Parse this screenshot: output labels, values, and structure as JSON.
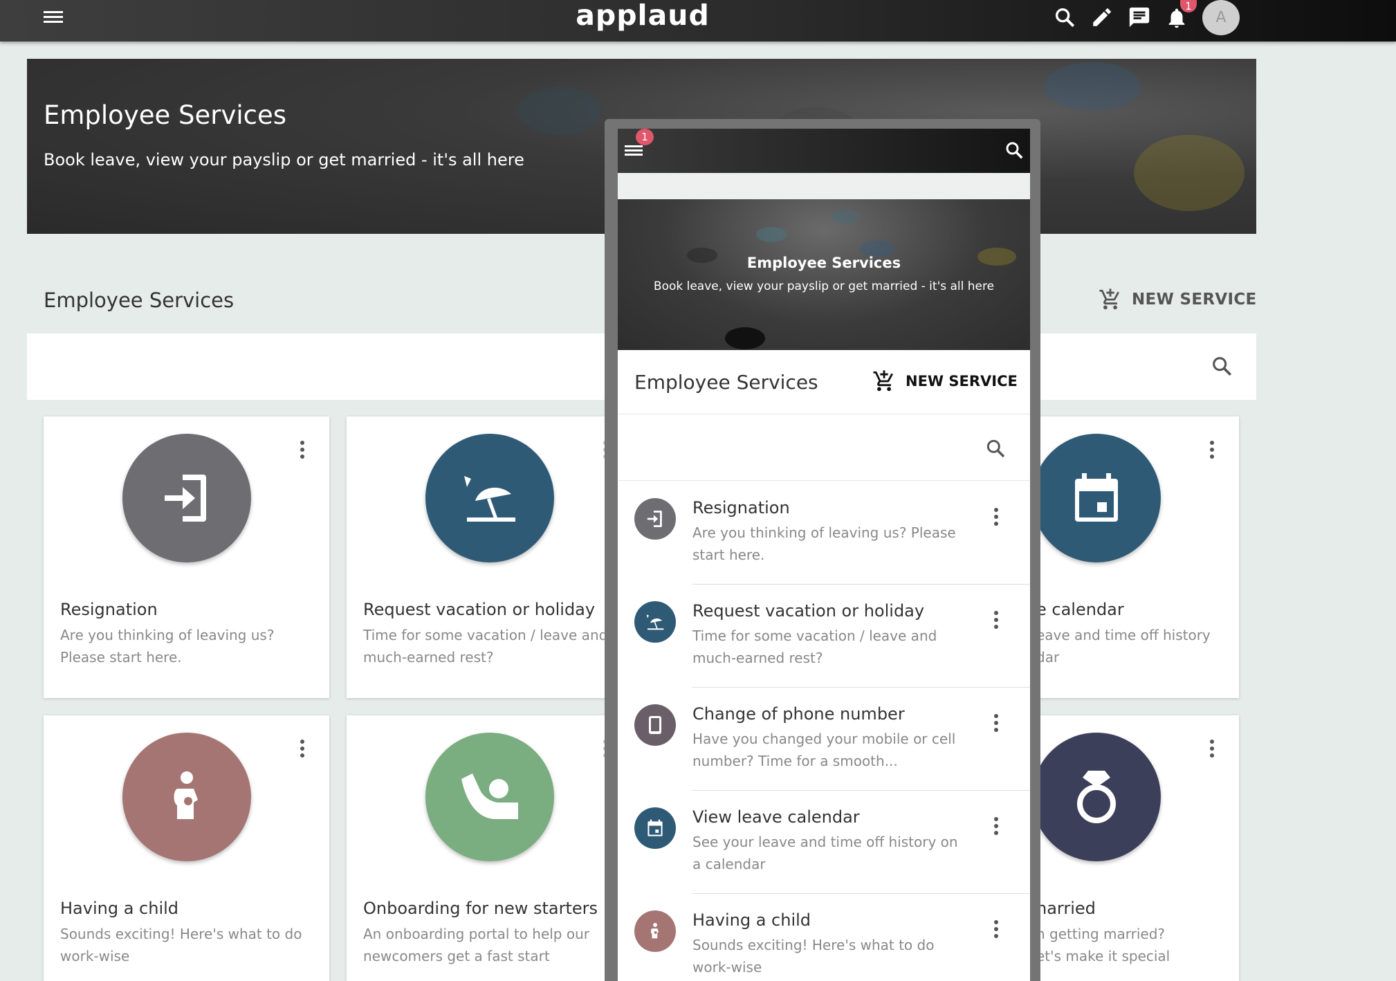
{
  "app": {
    "logo": "applaud",
    "notification_count": "1",
    "avatar_initial": "A",
    "icons": [
      "menu-icon",
      "search-icon",
      "edit-icon",
      "chat-icon",
      "bell-icon"
    ]
  },
  "hero": {
    "title": "Employee Services",
    "subtitle": "Book leave, view your payslip or get married - it's all here"
  },
  "section": {
    "title": "Employee Services",
    "new_service_label": "NEW SERVICE"
  },
  "cards": [
    {
      "title": "Resignation",
      "desc": "Are you thinking of leaving us? Please start here.",
      "icon": "resignation-icon",
      "color": "#6d6d72"
    },
    {
      "title": "Request vacation or holiday",
      "desc": "Time for some vacation / leave and much-earned rest?",
      "icon": "beach-icon",
      "color": "#2f5a76"
    },
    {
      "title": "e calendar",
      "desc": "eave and time off history\ndar",
      "icon": "calendar-icon",
      "color": "#2f5a76"
    },
    {
      "title": "Having a child",
      "desc": "Sounds exciting! Here's what to do work-wise",
      "icon": "pregnant-icon",
      "color": "#a57573"
    },
    {
      "title": "Onboarding for new starters",
      "desc": "An onboarding portal to help our newcomers get a fast start",
      "icon": "onboarding-icon",
      "color": "#7aad80"
    },
    {
      "title": "narried",
      "desc": "n getting married?\net's make it special",
      "icon": "ring-icon",
      "color": "#3c3f5a"
    }
  ],
  "mobile": {
    "notification_count": "1",
    "hero_title": "Employee Services",
    "hero_subtitle": "Book leave, view your payslip or get married - it's all here",
    "section_title": "Employee Services",
    "new_service_label": "NEW SERVICE",
    "rows": [
      {
        "title": "Resignation",
        "desc": "Are you thinking of leaving us? Please start here.",
        "color": "#6d6d72",
        "icon": "resignation-icon"
      },
      {
        "title": "Request vacation or holiday",
        "desc": "Time for some vacation / leave and much-earned rest?",
        "color": "#2f5a76",
        "icon": "beach-icon"
      },
      {
        "title": "Change of phone number",
        "desc": "Have you changed your mobile or cell number? Time for a smooth...",
        "color": "#6a5f68",
        "icon": "phone-icon"
      },
      {
        "title": "View leave calendar",
        "desc": "See your leave and time off history on a calendar",
        "color": "#2f5a76",
        "icon": "calendar-icon"
      },
      {
        "title": "Having a child",
        "desc": "Sounds exciting! Here's what to do work-wise",
        "color": "#a57573",
        "icon": "pregnant-icon"
      }
    ]
  }
}
